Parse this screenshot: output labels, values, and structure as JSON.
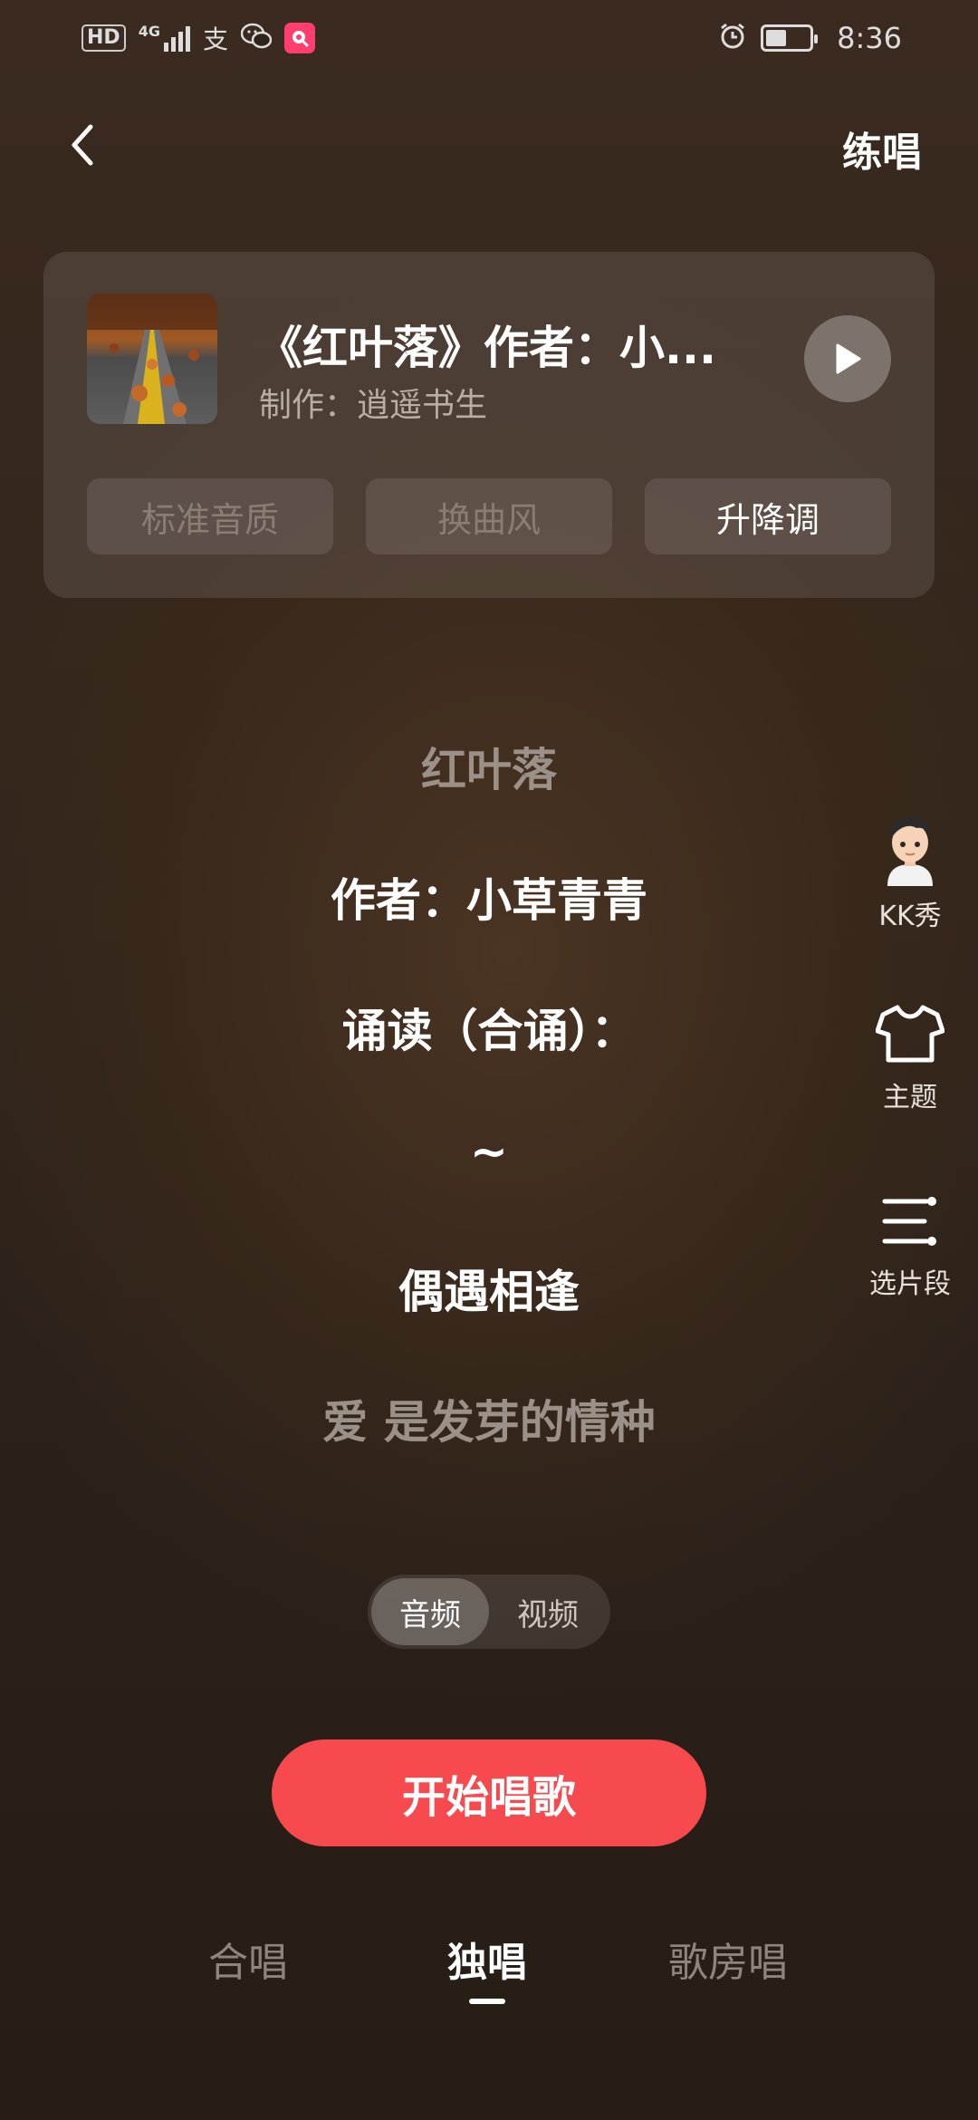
{
  "status_bar": {
    "hd_label": "HD",
    "network_label": "4G",
    "alipay_glyph": "支",
    "time": "8:36",
    "icons": [
      "hd-icon",
      "signal-icon",
      "alipay-icon",
      "wechat-icon",
      "app-icon",
      "alarm-icon",
      "battery-icon"
    ]
  },
  "header": {
    "back_icon": "back-arrow-icon",
    "practice_label": "练唱"
  },
  "song_card": {
    "title": "《红叶落》作者：小...",
    "producer": "制作：逍遥书生",
    "play_icon": "play-icon",
    "buttons": [
      {
        "label": "标准音质",
        "enabled": false
      },
      {
        "label": "换曲风",
        "enabled": false
      },
      {
        "label": "升降调",
        "enabled": true
      }
    ]
  },
  "lyrics": [
    {
      "text": "红叶落",
      "style": "dim"
    },
    {
      "text": "作者：小草青青",
      "style": "bright"
    },
    {
      "text": "诵读（合诵）：",
      "style": "bright"
    },
    {
      "text": "~",
      "style": "bright"
    },
    {
      "text": "偶遇相逢",
      "style": "bright"
    },
    {
      "text": "爱 是发芽的情种",
      "style": "dim"
    }
  ],
  "side_actions": [
    {
      "label": "KK秀",
      "icon": "avatar-icon"
    },
    {
      "label": "主题",
      "icon": "tshirt-icon"
    },
    {
      "label": "选片段",
      "icon": "segment-list-icon"
    }
  ],
  "media_toggle": {
    "options": [
      "音频",
      "视频"
    ],
    "selected": "音频"
  },
  "start_button": {
    "label": "开始唱歌"
  },
  "bottom_tabs": {
    "items": [
      "合唱",
      "独唱",
      "歌房唱"
    ],
    "selected": "独唱"
  },
  "colors": {
    "accent": "#f74a4f",
    "background": "#33261c"
  }
}
